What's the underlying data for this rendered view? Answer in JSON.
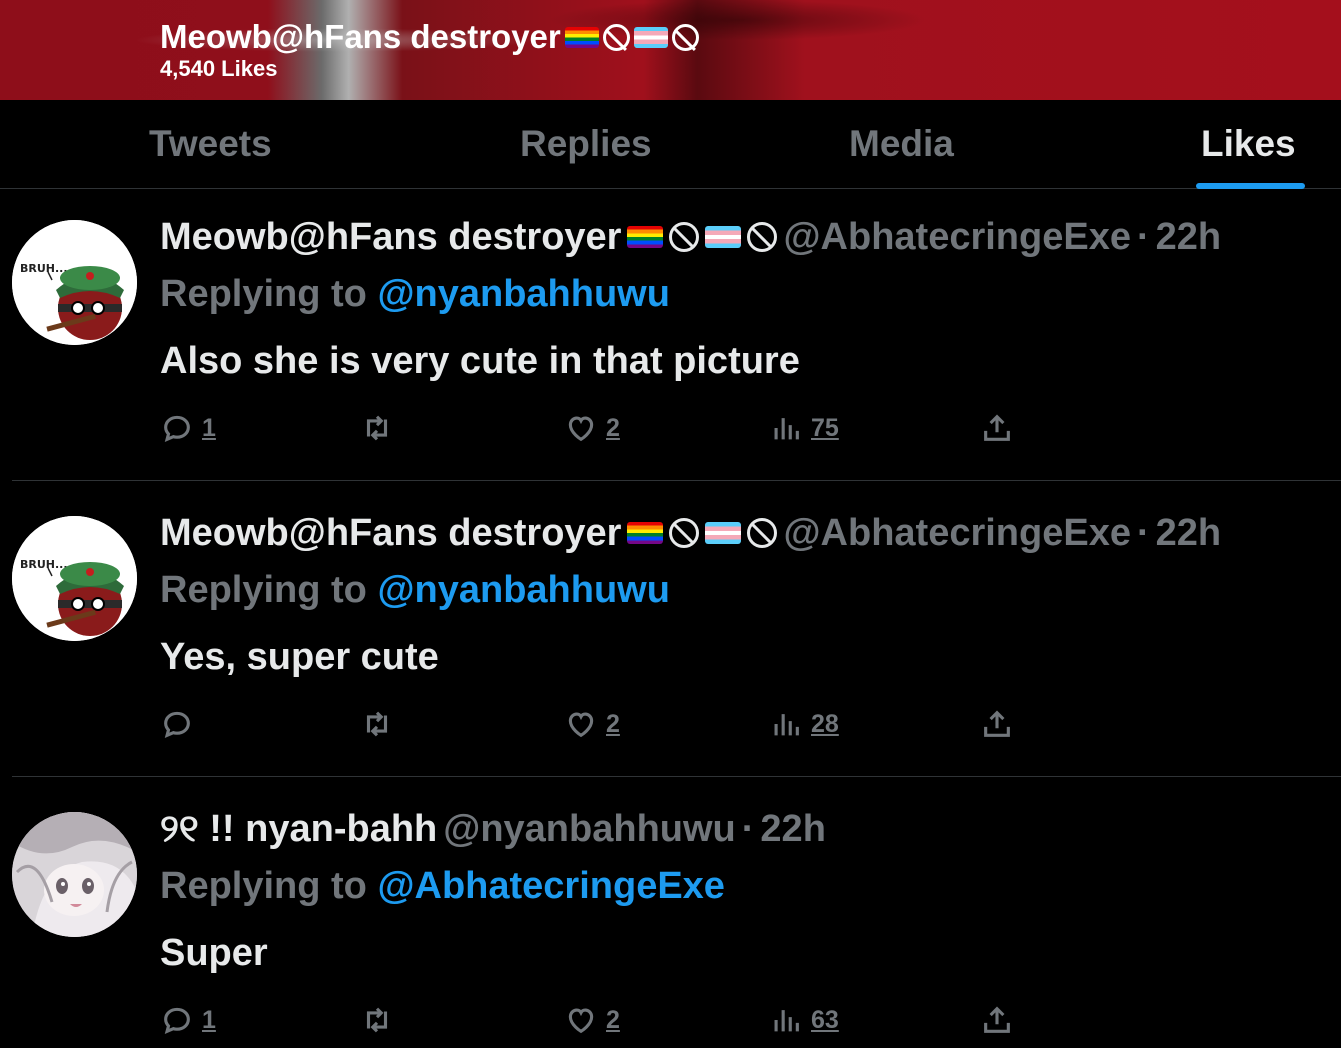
{
  "profile": {
    "name": "Meowb@hFans destroyer",
    "likes_count": "4,540 Likes"
  },
  "tabs": [
    {
      "label": "Tweets",
      "active": false
    },
    {
      "label": "Replies",
      "active": false
    },
    {
      "label": "Media",
      "active": false
    },
    {
      "label": "Likes",
      "active": true
    }
  ],
  "tweets": [
    {
      "name": "Meowb@hFans destroyer",
      "handle": "@AbhatecringeExe",
      "dot": "·",
      "time": "22h",
      "replying_prefix": "Replying to",
      "replying_to": "@nyanbahhuwu",
      "text": "Also she is very cute in that picture",
      "replies": "1",
      "retweets": "",
      "likes": "2",
      "views": "75",
      "avatar": "bruh-countryball"
    },
    {
      "name": "Meowb@hFans destroyer",
      "handle": "@AbhatecringeExe",
      "dot": "·",
      "time": "22h",
      "replying_prefix": "Replying to",
      "replying_to": "@nyanbahhuwu",
      "text": "Yes, super cute",
      "replies": "",
      "retweets": "",
      "likes": "2",
      "views": "28",
      "avatar": "bruh-countryball"
    },
    {
      "name": "୨୧ !! nyan-bahh",
      "handle": "@nyanbahhuwu",
      "dot": "·",
      "time": "22h",
      "replying_prefix": "Replying to",
      "replying_to": "@AbhatecringeExe",
      "text": "Super",
      "replies": "1",
      "retweets": "",
      "likes": "2",
      "views": "63",
      "avatar": "anime-girl"
    }
  ],
  "bruh_text": "BRUH...",
  "colors": {
    "accent": "#1d9bf0",
    "muted": "#71767b",
    "text": "#e7e9ea",
    "banner": "#a0111d"
  }
}
